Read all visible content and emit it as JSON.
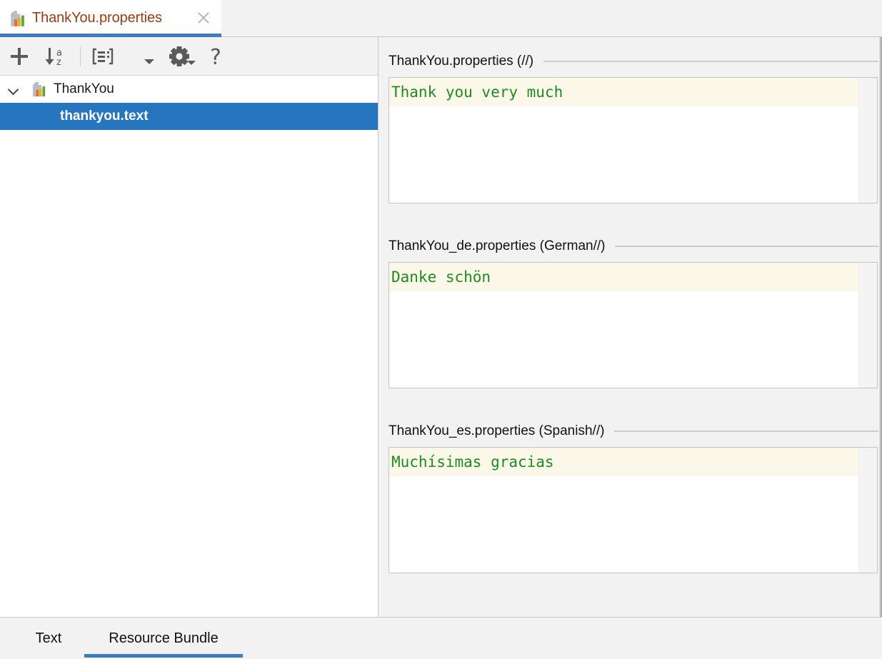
{
  "window": {
    "tab": {
      "title": "ThankYou.properties",
      "icon": "resource-bundle-icon",
      "close_icon": "close-icon",
      "active": true
    }
  },
  "toolbar": {
    "buttons": [
      {
        "name": "add-property-button",
        "icon": "plus-icon",
        "label": "+"
      },
      {
        "name": "sort-alphabetically-button",
        "icon": "sort-az-icon",
        "label": "↓az"
      },
      {
        "name": "group-by-prefix-button",
        "icon": "properties-list-icon",
        "label": ""
      },
      {
        "name": "group-dropdown-button",
        "icon": "chevron-down-icon",
        "label": ""
      },
      {
        "name": "settings-button",
        "icon": "gear-icon",
        "label": ""
      },
      {
        "name": "help-button",
        "icon": "question-mark-icon",
        "label": "?"
      }
    ]
  },
  "tree": {
    "root": {
      "label": "ThankYou",
      "icon": "resource-bundle-icon",
      "expanded": true,
      "chevron_icon": "chevron-down-icon"
    },
    "children": [
      {
        "label": "thankyou.text",
        "selected": true
      }
    ]
  },
  "sections": [
    {
      "title": "ThankYou.properties (//)",
      "locale": "",
      "value": "Thank you very much"
    },
    {
      "title": "ThankYou_de.properties (German//)",
      "locale": "German",
      "value": "Danke schön"
    },
    {
      "title": "ThankYou_es.properties (Spanish//)",
      "locale": "Spanish",
      "value": "Muchísimas gracias"
    }
  ],
  "bottom_tabs": [
    {
      "label": "Text",
      "active": false
    },
    {
      "label": "Resource Bundle",
      "active": true
    }
  ],
  "colors": {
    "accent": "#3c7cbf",
    "selection": "#2675bf",
    "tab_title": "#9c3b12",
    "editor_text": "#1f8b23",
    "current_line": "#fbf8e9",
    "panel_bg": "#f2f2f2"
  }
}
